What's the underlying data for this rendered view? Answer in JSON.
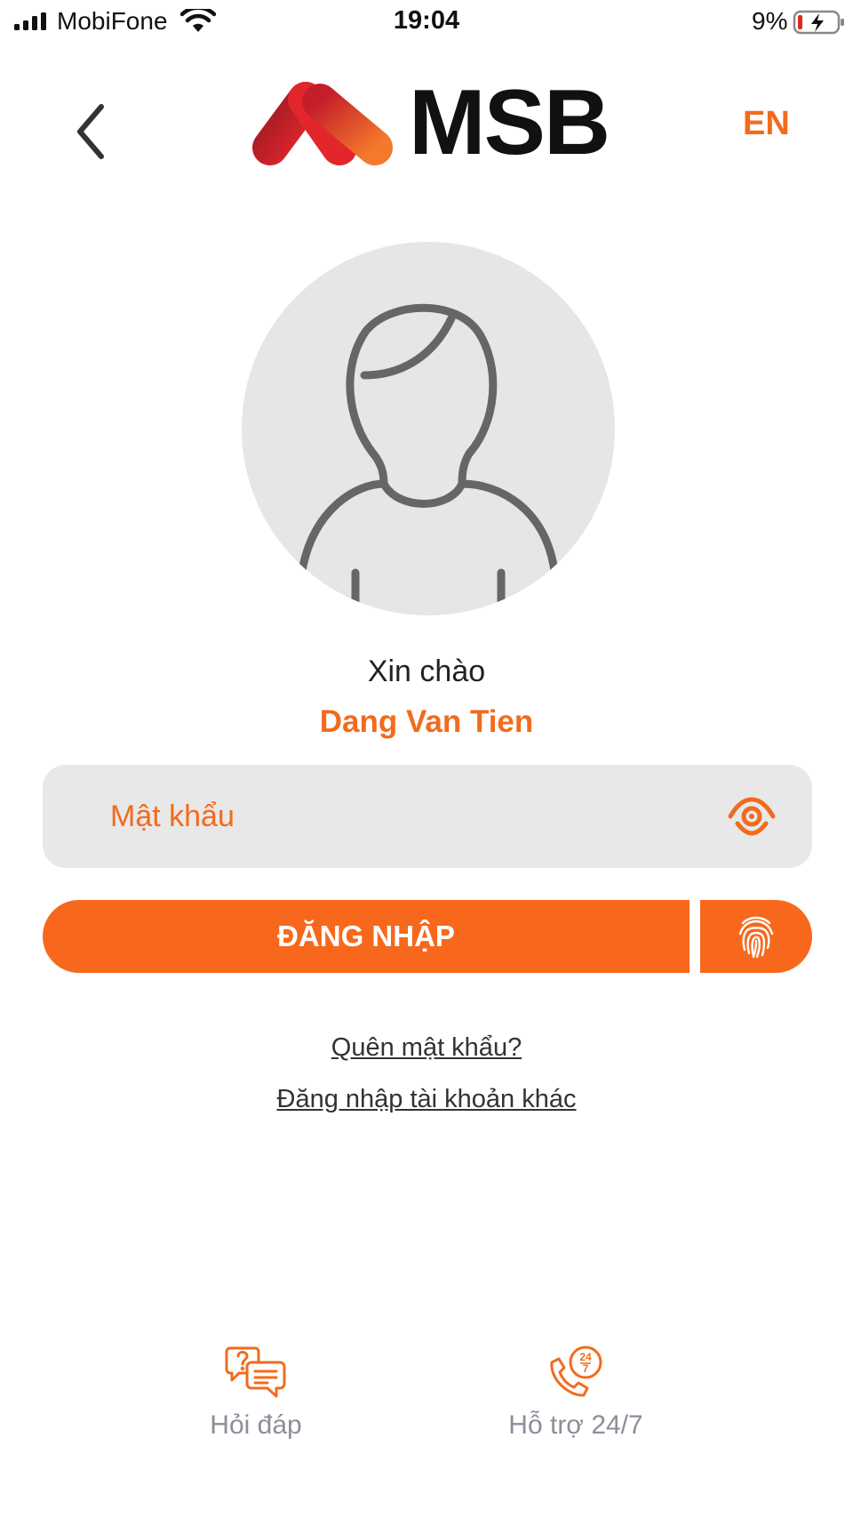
{
  "status_bar": {
    "carrier": "MobiFone",
    "time": "19:04",
    "battery_percent": "9%"
  },
  "header": {
    "back_icon": "chevron-left-icon",
    "logo_text": "MSB",
    "language_label": "EN"
  },
  "profile": {
    "avatar_icon": "user-silhouette-icon",
    "greeting": "Xin chào",
    "name": "Dang Van Tien"
  },
  "login_form": {
    "password_placeholder": "Mật khẩu",
    "password_value": "",
    "show_password_icon": "eye-icon",
    "login_button_label": "ĐĂNG NHẬP",
    "fingerprint_icon": "fingerprint-icon"
  },
  "links": {
    "forgot_password": "Quên mật khẩu?",
    "other_account": "Đăng nhập tài khoản khác"
  },
  "bottom_actions": [
    {
      "label": "Hỏi đáp",
      "icon": "faq-chat-icon"
    },
    {
      "label": "Hỗ trợ 24/7",
      "icon": "support-24-7-phone-icon"
    }
  ],
  "colors": {
    "accent": "#F26B1D",
    "button": "#F7681C",
    "field_background": "#E8E8E8",
    "avatar_background": "#E6E6E6",
    "secondary_text": "#8A8F9A"
  }
}
